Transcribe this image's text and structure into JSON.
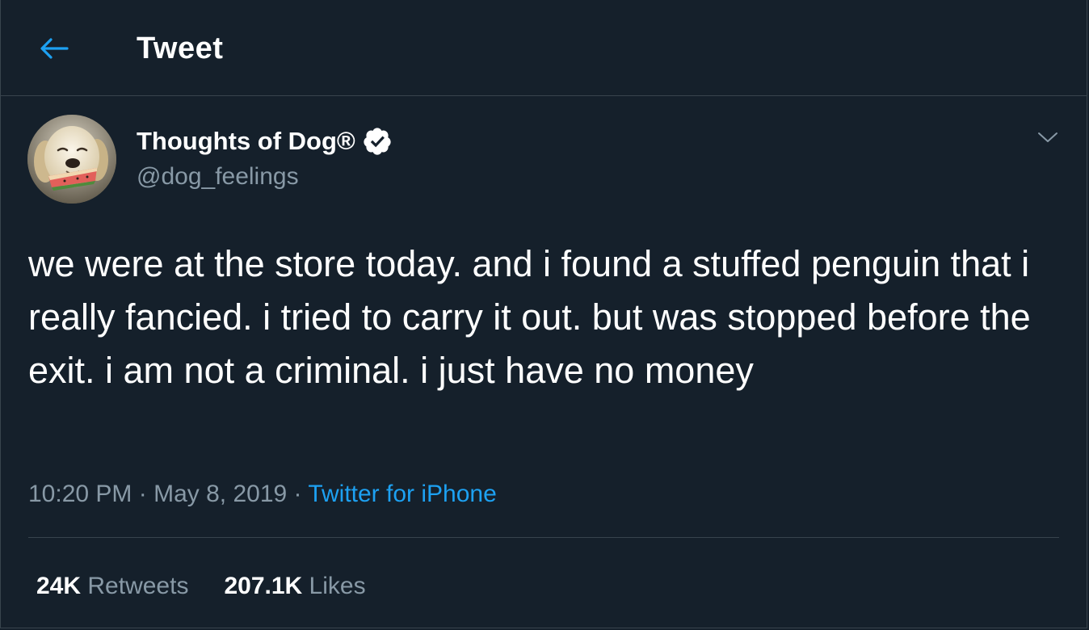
{
  "header": {
    "back_icon": "arrow-left-icon",
    "title": "Tweet"
  },
  "author": {
    "avatar": "dog-eating-watermelon-avatar",
    "name": "Thoughts of Dog®",
    "verified_icon": "verified-badge-icon",
    "handle": "@dog_feelings"
  },
  "menu_icon": "chevron-down-icon",
  "tweet": {
    "text": "we were at the store today. and i found a stuffed penguin that i really fancied. i tried to carry it out. but was stopped before the exit. i am not a criminal. i just have no money",
    "time": "10:20 PM",
    "sep1": " · ",
    "date": "May 8, 2019",
    "sep2": " · ",
    "source": "Twitter for iPhone"
  },
  "stats": {
    "retweets_count": "24K",
    "retweets_label": "Retweets",
    "likes_count": "207.1K",
    "likes_label": "Likes"
  },
  "colors": {
    "background": "#15202b",
    "border": "#38444d",
    "secondary_text": "#8899a6",
    "accent": "#1da1f2"
  }
}
